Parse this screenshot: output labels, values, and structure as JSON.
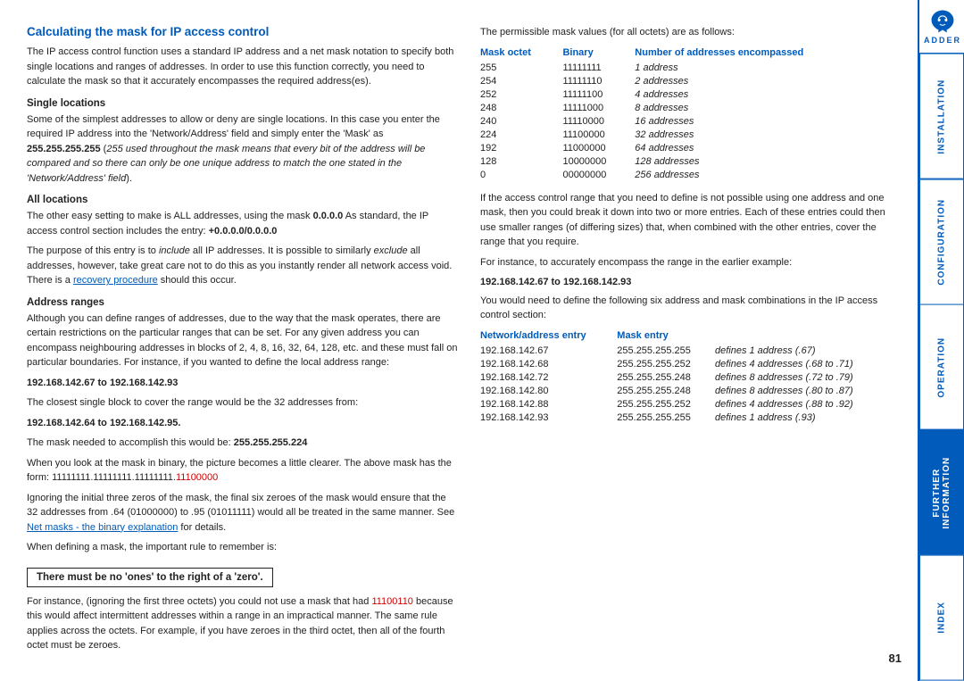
{
  "page": {
    "title": "Calculating the mask for IP access control",
    "page_number": "81"
  },
  "intro_para": "The IP access control function uses a standard IP address and a net mask notation to specify both single locations and ranges of addresses. In order to use this function correctly, you need to calculate the mask so that it accurately encompasses the required address(es).",
  "sections": {
    "single_locations": {
      "heading": "Single locations",
      "para1": "Some of the simplest addresses to allow or deny are single locations. In this case you enter the required IP address into the 'Network/Address' field and simply enter the 'Mask' as ",
      "mask_value": "255.255.255.255",
      "para1_suffix": " (",
      "italic_note": "255 used throughout the mask means that every bit of the address will be compared and so there can only be one unique address to match the one stated in the 'Network/Address' field",
      "italic_close": ")."
    },
    "all_locations": {
      "heading": "All locations",
      "para1": "The other easy setting to make is ALL addresses, using the mask ",
      "mask_value": "0.0.0.0",
      "para1_suffix": " As standard, the IP access control section includes the entry: ",
      "entry_value": "+0.0.0.0/0.0.0.0",
      "para2": "The purpose of this entry is to ",
      "include_italic": "include",
      "para2_suffix": " all IP addresses. It is possible to similarly ",
      "exclude_italic": "exclude",
      "para2_suffix2": " all addresses, however, take great care not to do this as you instantly render all network access void. There is a ",
      "link_text": "recovery procedure",
      "para2_end": " should this occur."
    },
    "address_ranges": {
      "heading": "Address ranges",
      "para1": "Although you can define ranges of addresses, due to the way that the mask operates, there are certain restrictions on the particular ranges that can be set. For any given address you can encompass neighbouring addresses in blocks of 2, 4, 8, 16, 32, 64, 128, etc. and these must fall on particular boundaries. For instance, if you wanted to define the local address range:",
      "range1": "192.168.142.67 to 192.168.142.93",
      "para2": "The closest single block to cover the range would be the 32 addresses from:",
      "range2": "192.168.142.64 to 192.168.142.95.",
      "para3": "The mask needed to accomplish this would be: ",
      "mask3": "255.255.255.224",
      "para4": "When you look at the mask in binary, the picture becomes a little clearer. The above mask has the form: 11111111.11111111.11111111.",
      "binary_highlight": "11100000",
      "para5": "Ignoring the initial three zeros of the mask, the final six zeroes of the mask would ensure that the 32 addresses from .64 (01000000) to .95 (01011111) would all be treated in the same manner. See ",
      "link2": "Net masks - the binary explanation",
      "para5_end": " for details.",
      "para6": "When defining a mask, the important rule to remember is:",
      "rule_text": "There must be no 'ones' to the right of a 'zero'.",
      "para7": "For instance, (ignoring the first three octets) you could not use a mask that had ",
      "bad_binary": "11100110",
      "para7_suffix": " because this would affect intermittent addresses within a range in an impractical manner. The same rule applies across the octets. For example, if you have zeroes in the third octet, then all of the fourth octet must be zeroes."
    }
  },
  "right_content": {
    "permissible_intro": "The permissible mask values (for all octets) are as follows:",
    "table_headers": {
      "mask_octet": "Mask octet",
      "binary": "Binary",
      "addresses": "Number of addresses encompassed"
    },
    "table_rows": [
      {
        "octet": "255",
        "binary": "11111111",
        "addresses": "1 address"
      },
      {
        "octet": "254",
        "binary": "11111110",
        "addresses": "2 addresses"
      },
      {
        "octet": "252",
        "binary": "11111100",
        "addresses": "4 addresses"
      },
      {
        "octet": "248",
        "binary": "11111000",
        "addresses": "8 addresses"
      },
      {
        "octet": "240",
        "binary": "11110000",
        "addresses": "16 addresses"
      },
      {
        "octet": "224",
        "binary": "11100000",
        "addresses": "32 addresses"
      },
      {
        "octet": "192",
        "binary": "11000000",
        "addresses": "64 addresses"
      },
      {
        "octet": "128",
        "binary": "10000000",
        "addresses": "128 addresses"
      },
      {
        "octet": "0",
        "binary": "00000000",
        "addresses": "256 addresses"
      }
    ],
    "para_impossible": "If the access control range that you need to define is not possible using one address and one mask, then you could break it down into two or more entries. Each of these entries could then use smaller ranges (of differing sizes) that, when combined with the other entries, cover the range that you require.",
    "para_instance": "For instance, to accurately encompass the range in the earlier example:",
    "ip_range_display": "192.168.142.67 to 192.168.142.93",
    "para_need": "You would need to define the following six address and mask combinations in the IP access control section:",
    "network_headers": {
      "network_entry": "Network/address entry",
      "mask_entry": "Mask entry"
    },
    "network_rows": [
      {
        "network": "192.168.142.67",
        "mask": "255.255.255.255",
        "defines": "defines 1 address (.67)"
      },
      {
        "network": "192.168.142.68",
        "mask": "255.255.255.252",
        "defines": "defines 4 addresses (.68 to .71)"
      },
      {
        "network": "192.168.142.72",
        "mask": "255.255.255.248",
        "defines": "defines 8 addresses (.72 to .79)"
      },
      {
        "network": "192.168.142.80",
        "mask": "255.255.255.248",
        "defines": "defines 8 addresses (.80 to .87)"
      },
      {
        "network": "192.168.142.88",
        "mask": "255.255.255.252",
        "defines": "defines 4 addresses (.88 to .92)"
      },
      {
        "network": "192.168.142.93",
        "mask": "255.255.255.255",
        "defines": "defines 1 address (.93)"
      }
    ]
  },
  "sidebar": {
    "tabs": [
      {
        "label": "INSTALLATION",
        "active": false
      },
      {
        "label": "CONFIGURATION",
        "active": false
      },
      {
        "label": "OPERATION",
        "active": false
      },
      {
        "label": "FURTHER INFORMATION",
        "active": true
      },
      {
        "label": "INDEX",
        "active": false
      }
    ],
    "logo_text": "ADDER"
  }
}
